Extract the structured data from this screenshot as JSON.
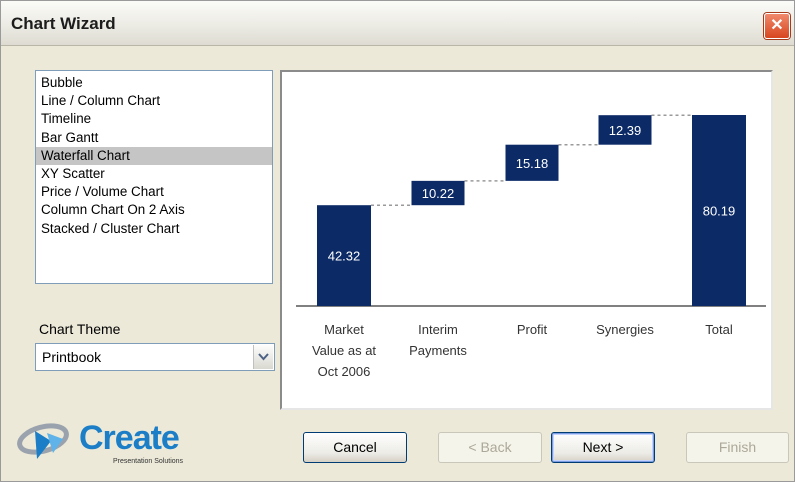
{
  "window": {
    "title": "Chart Wizard",
    "close_glyph": "✕"
  },
  "chart_types": {
    "items": [
      "Bubble",
      "Line / Column Chart",
      "Timeline",
      "Bar Gantt",
      "Waterfall Chart",
      "XY Scatter",
      "Price / Volume Chart",
      "Column Chart On 2 Axis",
      "Stacked / Cluster Chart"
    ],
    "selected_index": 4
  },
  "theme": {
    "label": "Chart Theme",
    "value": "Printbook"
  },
  "buttons": {
    "cancel": "Cancel",
    "back": "< Back",
    "next": "Next >",
    "finish": "Finish"
  },
  "logo": {
    "word": "Create",
    "tagline": "Presentation Solutions"
  },
  "colors": {
    "bar": "#0b2a66",
    "connector": "#9a9a9a",
    "selection": "#c5c5c5"
  },
  "chart_data": {
    "type": "waterfall",
    "categories": [
      [
        "Market",
        "Value as at",
        "Oct 2006"
      ],
      [
        "Interim",
        "Payments"
      ],
      [
        "Profit"
      ],
      [
        "Synergies"
      ],
      [
        "Total"
      ]
    ],
    "values": [
      42.32,
      10.22,
      15.18,
      12.39,
      80.19
    ],
    "labels": [
      "42.32",
      "10.22",
      "15.18",
      "12.39",
      "80.19"
    ],
    "total_index": 4,
    "ylim": [
      0,
      80.19
    ],
    "connectors": "dashed"
  }
}
